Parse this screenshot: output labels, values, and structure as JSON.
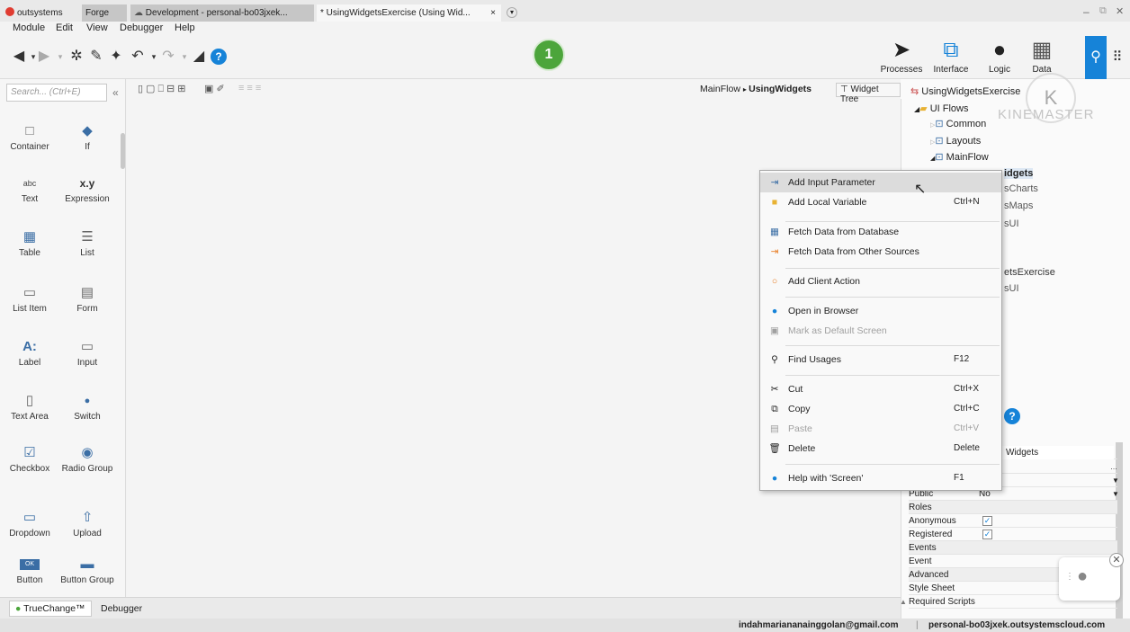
{
  "tabs": [
    {
      "label": "outsystems"
    },
    {
      "label": "Forge"
    },
    {
      "label": "Development - personal-bo03jxek..."
    },
    {
      "label": "* UsingWidgetsExercise (Using Wid..."
    }
  ],
  "tab_close": "×",
  "tab_dropdown": "▾",
  "window_controls": {
    "minimize": "–",
    "restore": "⧉",
    "close": "✕"
  },
  "menu": [
    "Module",
    "Edit",
    "View",
    "Debugger",
    "Help"
  ],
  "step_badge": "1",
  "modes": [
    {
      "label": "Processes"
    },
    {
      "label": "Interface"
    },
    {
      "label": "Logic"
    },
    {
      "label": "Data"
    }
  ],
  "watermark": "KINEMASTER",
  "search": {
    "placeholder": "Search... (Ctrl+E)"
  },
  "widgets": [
    {
      "label": "Container",
      "icon": "□"
    },
    {
      "label": "If",
      "icon": "◆"
    },
    {
      "label": "Text",
      "icon": "abc"
    },
    {
      "label": "Expression",
      "icon": "x.y"
    },
    {
      "label": "Table",
      "icon": "▦"
    },
    {
      "label": "List",
      "icon": "☰"
    },
    {
      "label": "List Item",
      "icon": "▭"
    },
    {
      "label": "Form",
      "icon": "▤"
    },
    {
      "label": "Label",
      "icon": "A:"
    },
    {
      "label": "Input",
      "icon": "▭"
    },
    {
      "label": "Text Area",
      "icon": "▯"
    },
    {
      "label": "Switch",
      "icon": "●"
    },
    {
      "label": "Checkbox",
      "icon": "☑"
    },
    {
      "label": "Radio Group",
      "icon": "◉"
    },
    {
      "label": "Dropdown",
      "icon": "▭"
    },
    {
      "label": "Upload",
      "icon": "⇧"
    },
    {
      "label": "Button",
      "icon": "OK"
    },
    {
      "label": "Button Group",
      "icon": "▬"
    }
  ],
  "breadcrumb": {
    "flow": "MainFlow",
    "screen": "UsingWidgets"
  },
  "widget_tree_label": "Widget Tree",
  "tree": {
    "root": "UsingWidgetsExercise",
    "ui_flows": "UI Flows",
    "common": "Common",
    "layouts": "Layouts",
    "mainflow": "MainFlow",
    "partial_items": [
      "idgets",
      "sCharts",
      "sMaps",
      "sUI",
      "etsExercise",
      "sUI"
    ]
  },
  "context_menu": [
    {
      "label": "Add Input Parameter",
      "shortcut": "",
      "icon": "input-param-icon",
      "disabled": false
    },
    {
      "label": "Add Local Variable",
      "shortcut": "Ctrl+N",
      "icon": "local-var-icon",
      "disabled": false
    },
    {
      "label": "Fetch Data from Database",
      "shortcut": "",
      "icon": "aggregate-icon",
      "disabled": false
    },
    {
      "label": "Fetch Data from Other Sources",
      "shortcut": "",
      "icon": "data-action-icon",
      "disabled": false
    },
    {
      "label": "Add Client Action",
      "shortcut": "",
      "icon": "client-action-icon",
      "disabled": false
    },
    {
      "label": "Open in Browser",
      "shortcut": "",
      "icon": "browser-icon",
      "disabled": false
    },
    {
      "label": "Mark as Default Screen",
      "shortcut": "",
      "icon": "default-screen-icon",
      "disabled": true
    },
    {
      "label": "Find Usages",
      "shortcut": "F12",
      "icon": "search-icon",
      "disabled": false
    },
    {
      "label": "Cut",
      "shortcut": "Ctrl+X",
      "icon": "cut-icon",
      "disabled": false
    },
    {
      "label": "Copy",
      "shortcut": "Ctrl+C",
      "icon": "copy-icon",
      "disabled": false
    },
    {
      "label": "Paste",
      "shortcut": "Ctrl+V",
      "icon": "paste-icon",
      "disabled": true
    },
    {
      "label": "Delete",
      "shortcut": "Delete",
      "icon": "delete-icon",
      "disabled": false
    },
    {
      "label": "Help with 'Screen'",
      "shortcut": "F1",
      "icon": "help-icon",
      "disabled": false
    }
  ],
  "properties": {
    "name_value": "Widgets",
    "public_label": "Public",
    "public_value": "No",
    "roles_label": "Roles",
    "anonymous_label": "Anonymous",
    "registered_label": "Registered",
    "events_label": "Events",
    "event_label": "Event",
    "advanced_label": "Advanced",
    "style_sheet_label": "Style Sheet",
    "required_scripts_label": "Required Scripts"
  },
  "bottom_tabs": [
    {
      "label": "TrueChange™"
    },
    {
      "label": "Debugger"
    }
  ],
  "status": {
    "email": "indahmariananainggolan@gmail.com",
    "server": "personal-bo03jxek.outsystemscloud.com"
  },
  "colors": {
    "accent": "#1683d8",
    "badge_green": "#4ca53b",
    "brand_red": "#e03c31"
  }
}
